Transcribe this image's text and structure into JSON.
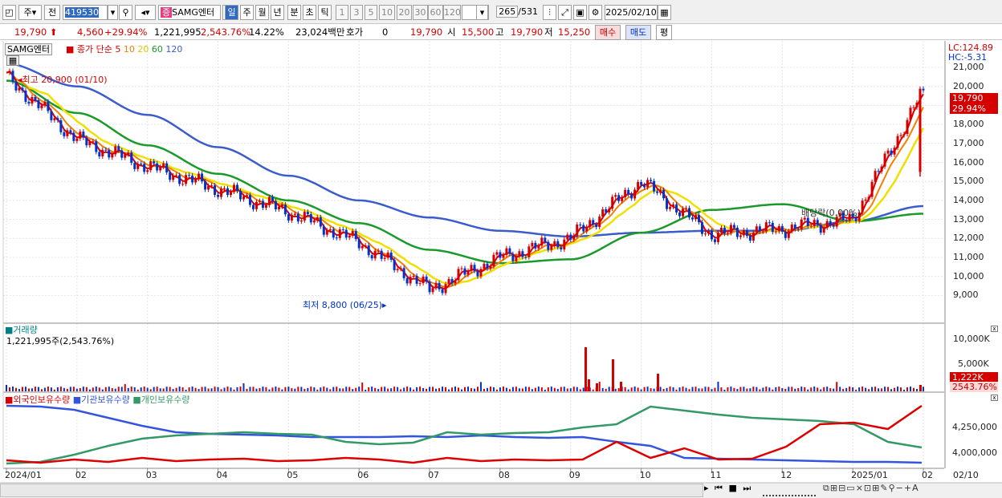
{
  "toolbar": {
    "prefix_btn": "주",
    "jeon_btn": "전",
    "code": "419530",
    "stock_name": "SAMG엔터",
    "period_day": "일",
    "period_week": "주",
    "period_month": "월",
    "period_year": "년",
    "period_min": "분",
    "period_sec": "초",
    "period_tick": "틱",
    "intervals": [
      "1",
      "3",
      "5",
      "10",
      "20",
      "30",
      "60",
      "120"
    ],
    "count": "265",
    "total": "/531",
    "date": "2025/02/10"
  },
  "quote": {
    "price": "19,790",
    "change": "4,560",
    "change_pct": "+29.94%",
    "volume": "1,221,995",
    "volume_ratio": "2,543.76%",
    "turnover": "14.22%",
    "trade_value": "23,024백만",
    "hoga_label": "호가",
    "hoga_value": "0",
    "hoga_price": "19,790",
    "open_label": "시",
    "open": "15,500",
    "high_label": "고",
    "high": "19,790",
    "low_label": "저",
    "low": "15,250",
    "buy_btn": "매수",
    "sell_btn": "매도",
    "eval_btn": "평"
  },
  "legend": {
    "name": "SAMG엔터",
    "series": "종가 단순",
    "ma5": "5",
    "ma10": "10",
    "ma20": "20",
    "ma60": "60",
    "ma120": "120"
  },
  "price_panel": {
    "lc": "LC:124.89",
    "hc": "HC:-5.31",
    "y_ticks": [
      "21,000",
      "20,000",
      "19,000",
      "18,000",
      "17,000",
      "16,000",
      "15,000",
      "14,000",
      "13,000",
      "12,000",
      "11,000",
      "10,000",
      "9,000"
    ],
    "high_note": "최고 20,900 (01/10)",
    "low_note": "최저 8,800 (06/25)",
    "dividend_note": "배당락(0.00%)",
    "cur_price": "19,790",
    "cur_pct": "29.94%"
  },
  "volume_panel": {
    "title": "거래량",
    "value_line": "1,221,995주(2,543.76%)",
    "y_ticks": [
      "10,000K",
      "5,000K"
    ],
    "cur_tag": "1,222K",
    "cur_pct": "2543.76%"
  },
  "holdings_panel": {
    "series_foreign": "외국인보유수량",
    "series_inst": "기관보유수량",
    "series_indiv": "개인보유수량",
    "y_ticks": [
      "4,250,000",
      "4,000,000"
    ]
  },
  "x_axis": {
    "labels": [
      "2024/01",
      "02",
      "03",
      "04",
      "05",
      "06",
      "07",
      "08",
      "09",
      "10",
      "11",
      "12",
      "2025/01",
      "02"
    ],
    "right_label": "02/10"
  },
  "colors": {
    "up": "#d40000",
    "down": "#0033cc",
    "ma5": "#e00000",
    "ma10": "#f08000",
    "ma20": "#f0e000",
    "ma60": "#1a9a2a",
    "ma120": "#3a5ccc",
    "foreign": "#dd0000",
    "inst": "#3355dd",
    "indiv": "#339966"
  },
  "chart_data": {
    "type": "line",
    "title": "SAMG엔터",
    "x": [
      "2024/01",
      "02",
      "03",
      "04",
      "05",
      "06",
      "07",
      "08",
      "09",
      "10",
      "11",
      "12",
      "2025/01",
      "02"
    ],
    "series": [
      {
        "name": "종가",
        "values": [
          20500,
          17200,
          15800,
          14600,
          13400,
          11800,
          9300,
          11000,
          12000,
          15000,
          12200,
          12500,
          13000,
          19790
        ]
      },
      {
        "name": "60",
        "values": [
          20300,
          18600,
          16900,
          15400,
          14000,
          12800,
          11400,
          10700,
          10900,
          12300,
          13500,
          13800,
          12900,
          13300
        ]
      },
      {
        "name": "120",
        "values": [
          21200,
          20000,
          18500,
          16800,
          15300,
          14000,
          13100,
          12400,
          12100,
          12300,
          12400,
          12400,
          12900,
          13700
        ]
      }
    ],
    "ylim": [
      8500,
      21500
    ],
    "annotations": [
      "최고 20,900 (01/10)",
      "최저 8,800 (06/25)",
      "배당락(0.00%)"
    ]
  }
}
